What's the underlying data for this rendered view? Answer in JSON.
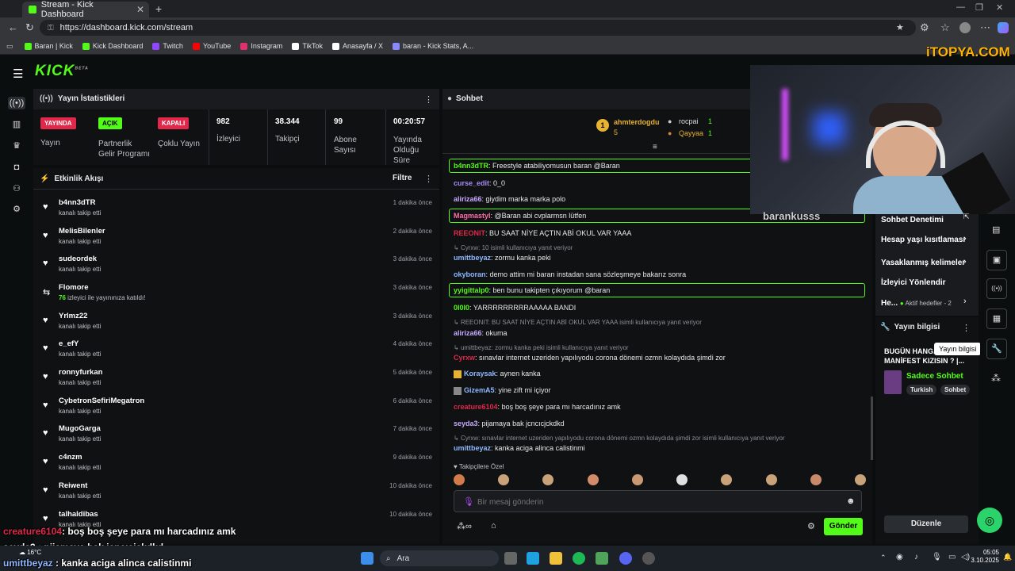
{
  "browser": {
    "tab_title": "Stream - Kick Dashboard",
    "url": "https://dashboard.kick.com/stream",
    "bookmarks": [
      {
        "label": "Baran | Kick",
        "color": "#53fc18"
      },
      {
        "label": "Kick Dashboard",
        "color": "#53fc18"
      },
      {
        "label": "Twitch",
        "color": "#9146ff"
      },
      {
        "label": "YouTube",
        "color": "#ff0000"
      },
      {
        "label": "Instagram",
        "color": "#e1306c"
      },
      {
        "label": "TikTok",
        "color": "#ffffff"
      },
      {
        "label": "Anasayfa / X",
        "color": "#ffffff"
      },
      {
        "label": "baran - Kick Stats, A...",
        "color": "#8888ff"
      }
    ]
  },
  "header": {
    "logo": "KICK",
    "logo_sup": "BETA"
  },
  "stats_panel": {
    "title": "Yayın İstatistikleri",
    "items": [
      {
        "badge": "YAYINDA",
        "badge_color": "#e0284a",
        "label": "Yayın"
      },
      {
        "badge": "AÇIK",
        "badge_color": "#53fc18",
        "label": "Partnerlik Gelir Programı"
      },
      {
        "badge": "KAPALI",
        "badge_color": "#e0284a",
        "label": "Çoklu Yayın"
      },
      {
        "value": "982",
        "label": "İzleyici"
      },
      {
        "value": "38.344",
        "label": "Takipçi"
      },
      {
        "value": "99",
        "label": "Abone Sayısı"
      },
      {
        "value": "00:20:57",
        "label": "Yayında Olduğu Süre"
      }
    ]
  },
  "activity": {
    "title": "Etkinlik Akışı",
    "filter": "Filtre",
    "rows": [
      {
        "name": "b4nn3dTR",
        "sub": "kanalı takip etti",
        "time": "1 dakika önce"
      },
      {
        "name": "MelisBilenler",
        "sub": "kanalı takip etti",
        "time": "2 dakika önce"
      },
      {
        "name": "sudeordek",
        "sub": "kanalı takip etti",
        "time": "3 dakika önce"
      },
      {
        "name": "Flomore",
        "sub_count": "76",
        "sub": "izleyici ile yayınınıza katıldı!",
        "time": "3 dakika önce"
      },
      {
        "name": "Yrlmz22",
        "sub": "kanalı takip etti",
        "time": "3 dakika önce"
      },
      {
        "name": "e_efY",
        "sub": "kanalı takip etti",
        "time": "4 dakika önce"
      },
      {
        "name": "ronnyfurkan",
        "sub": "kanalı takip etti",
        "time": "5 dakika önce"
      },
      {
        "name": "CybetronSefiriMegatron",
        "sub": "kanalı takip etti",
        "time": "6 dakika önce"
      },
      {
        "name": "MugoGarga",
        "sub": "kanalı takip etti",
        "time": "7 dakika önce"
      },
      {
        "name": "c4nzm",
        "sub": "kanalı takip etti",
        "time": "9 dakika önce"
      },
      {
        "name": "Reiwent",
        "sub": "kanalı takip etti",
        "time": "10 dakika önce"
      },
      {
        "name": "talhaldibas",
        "sub": "kanalı takip etti",
        "time": "10 dakika önce"
      }
    ]
  },
  "chat": {
    "title": "Sohbet",
    "leaders": {
      "first": {
        "name": "ahmterdogdu",
        "count": "5"
      },
      "second": {
        "name": "rocpai",
        "count": "1"
      },
      "third": {
        "name": "Qayyaa",
        "count": "1"
      }
    },
    "messages": [
      {
        "user": "b4nn3dTR",
        "color": "#53fc18",
        "text": "Freestyle atabiliyomusun baran @Baran",
        "boxed": true
      },
      {
        "user": "curse_edit",
        "color": "#a98cf7",
        "text": "0_0"
      },
      {
        "user": "aliriza66",
        "color": "#c7a9ff",
        "text": "giydim marka marka polo"
      },
      {
        "user": "Magmastyl",
        "color": "#ff6fa8",
        "text": "@Baran abi cvplarmsn lütfen",
        "boxed": true
      },
      {
        "user": "REEONIT",
        "color": "#e0284a",
        "text": "BU SAAT NİYE AÇTIN ABİ OKUL VAR YAAA"
      },
      {
        "reply": "Cyrxw: 10 isimli kullanıcıya yanıt veriyor"
      },
      {
        "user": "umittbeyaz",
        "color": "#8fb7ff",
        "text": "zormu kanka peki"
      },
      {
        "user": "okyboran",
        "color": "#8fb7ff",
        "text": "demo attim mi baran instadan sana sözleşmeye bakarız sonra"
      },
      {
        "user": "yyigittalp0",
        "color": "#53fc18",
        "text": "ben bunu takipten çıkıyorum @baran",
        "boxed": true
      },
      {
        "user": "0I0I0",
        "color": "#53fc18",
        "text": "YARRRRRRRRRAAAAA BANDI"
      },
      {
        "reply": "REEONIT: BU SAAT NİYE AÇTIN ABİ OKUL VAR YAAA isimli kullanıcıya yanıt veriyor"
      },
      {
        "user": "aliriza66",
        "color": "#c7a9ff",
        "text": "okuma"
      },
      {
        "reply": "umittbeyaz: zormu kanka peki isimli kullanıcıya yanıt veriyor"
      },
      {
        "user": "Cyrxw",
        "color": "#e0284a",
        "text": "sınavlar internet uzeriden yapılıyodu corona dönemi ozmn kolaydıda şimdi zor"
      },
      {
        "user": "Koraysak",
        "color": "#8fb7ff",
        "text": "aynen kanka"
      },
      {
        "user": "GizemA5",
        "color": "#8fb7ff",
        "text": "yine zift mi içiyor"
      },
      {
        "user": "creature6104",
        "color": "#e0284a",
        "text": "boş boş şeye para mı harcadınız amk"
      },
      {
        "user": "seyda3",
        "color": "#c7a9ff",
        "text": "pijamaya bak jcncıcjckdkd"
      },
      {
        "reply": "Cyrxw: sınavlar internet uzeriden yapılıyodu corona dönemi ozmn kolaydıda şimdi zor isimli kullanıcıya yanıt veriyor"
      },
      {
        "user": "umittbeyaz",
        "color": "#8fb7ff",
        "text": "kanka aciga alinca calistinmi"
      }
    ],
    "followers_label": "Takipçilere Özel",
    "input_placeholder": "Bir mesaj gönderin",
    "send": "Gönder"
  },
  "webcam": {
    "name_overlay": "barankusss",
    "watermark": "iTOPYA.COM"
  },
  "right_panel": {
    "menu": [
      {
        "label": "Sohbet Denetimi"
      },
      {
        "label": "Hesap yaşı kısıtlaması"
      },
      {
        "label": "Yasaklanmış kelimeler"
      },
      {
        "label": "İzleyici Yönlendir"
      },
      {
        "label": "He...",
        "extra": "Aktif hedefler - 2"
      }
    ],
    "stream_info_title": "Yayın bilgisi",
    "stream_title": "BUGÜN HANG... MANİFEST KIZISIN ? |...",
    "category": "Sadece Sohbet",
    "tags": [
      "Turkish",
      "Sohbet"
    ],
    "tooltip": "Yayın bilgisi",
    "edit": "Düzenle"
  },
  "overlay_chat": [
    {
      "user": "creature6104",
      "text": ": boş boş şeye para mı harcadınız amk",
      "color": "#e0284a"
    },
    {
      "user": "seyda3",
      "text": " : pijamaya bak jcncıcjckdkd",
      "color": "#ffffff"
    },
    {
      "user": "umittbeyaz",
      "text": " : kanka aciga alinca calistinmi",
      "color": "#8fb7ff"
    }
  ],
  "taskbar": {
    "search": "Ara",
    "weather": "16°C",
    "time": "05:05",
    "date": "3.10.2025"
  }
}
